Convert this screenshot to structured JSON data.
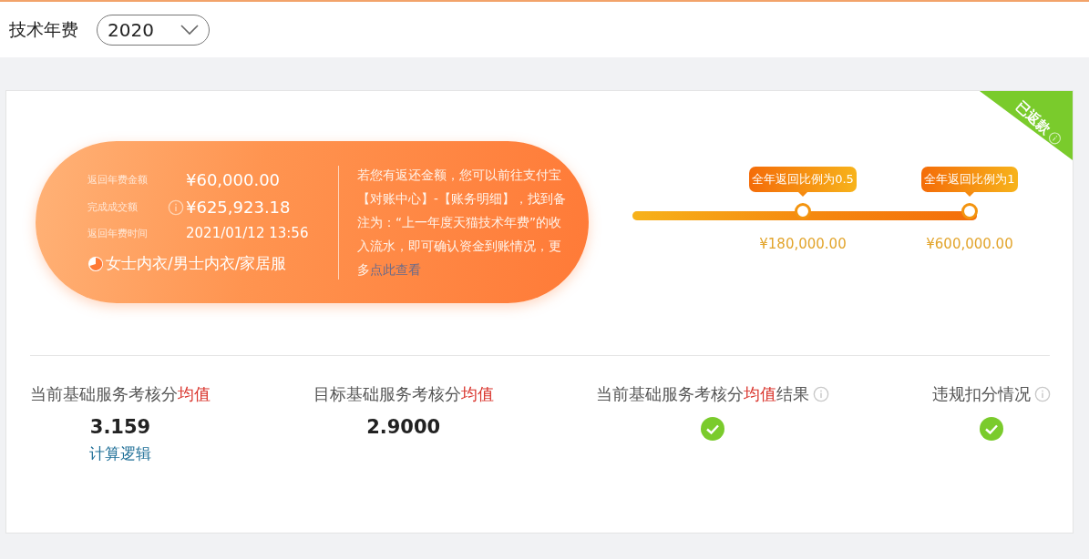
{
  "header": {
    "label": "技术年费",
    "year_select": {
      "value": "2020"
    }
  },
  "card": {
    "ribbon": {
      "text": "已返款",
      "info": true
    },
    "rebate": {
      "rows": [
        {
          "label": "返回年费金额",
          "value": "¥60,000.00"
        },
        {
          "label": "完成成交额",
          "value": "¥625,923.18",
          "info": true
        },
        {
          "label": "返回年费时间",
          "value": "2021/01/12 13:56"
        }
      ],
      "category": "女士内衣/男士内衣/家居服",
      "note": "若您有返还金额，您可以前往支付宝【对账中心】-【账务明细】，找到备注为：“上一年度天猫技术年费”的收入流水，即可确认资金到账情况，更多",
      "note_link": "点此查看"
    },
    "progress": {
      "level": 1,
      "milestones": [
        {
          "tooltip": "全年返回比例为0.5",
          "amount": "¥180,000.00",
          "reached": true
        },
        {
          "tooltip": "全年返回比例为1",
          "amount": "¥600,000.00",
          "reached": true
        }
      ]
    },
    "metrics": [
      {
        "kind": "value",
        "label": "当前基础服务考核分",
        "highlight": "均值",
        "value": "3.159",
        "link": "计算逻辑"
      },
      {
        "kind": "value",
        "label": "目标基础服务考核分",
        "highlight": "均值",
        "value": "2.9000"
      },
      {
        "kind": "check",
        "label": "当前基础服务考核分",
        "highlight": "均值",
        "suffix": "结果",
        "info": true,
        "passed": true
      },
      {
        "kind": "check",
        "label": "违规扣分情况",
        "info": true,
        "passed": true
      }
    ]
  }
}
